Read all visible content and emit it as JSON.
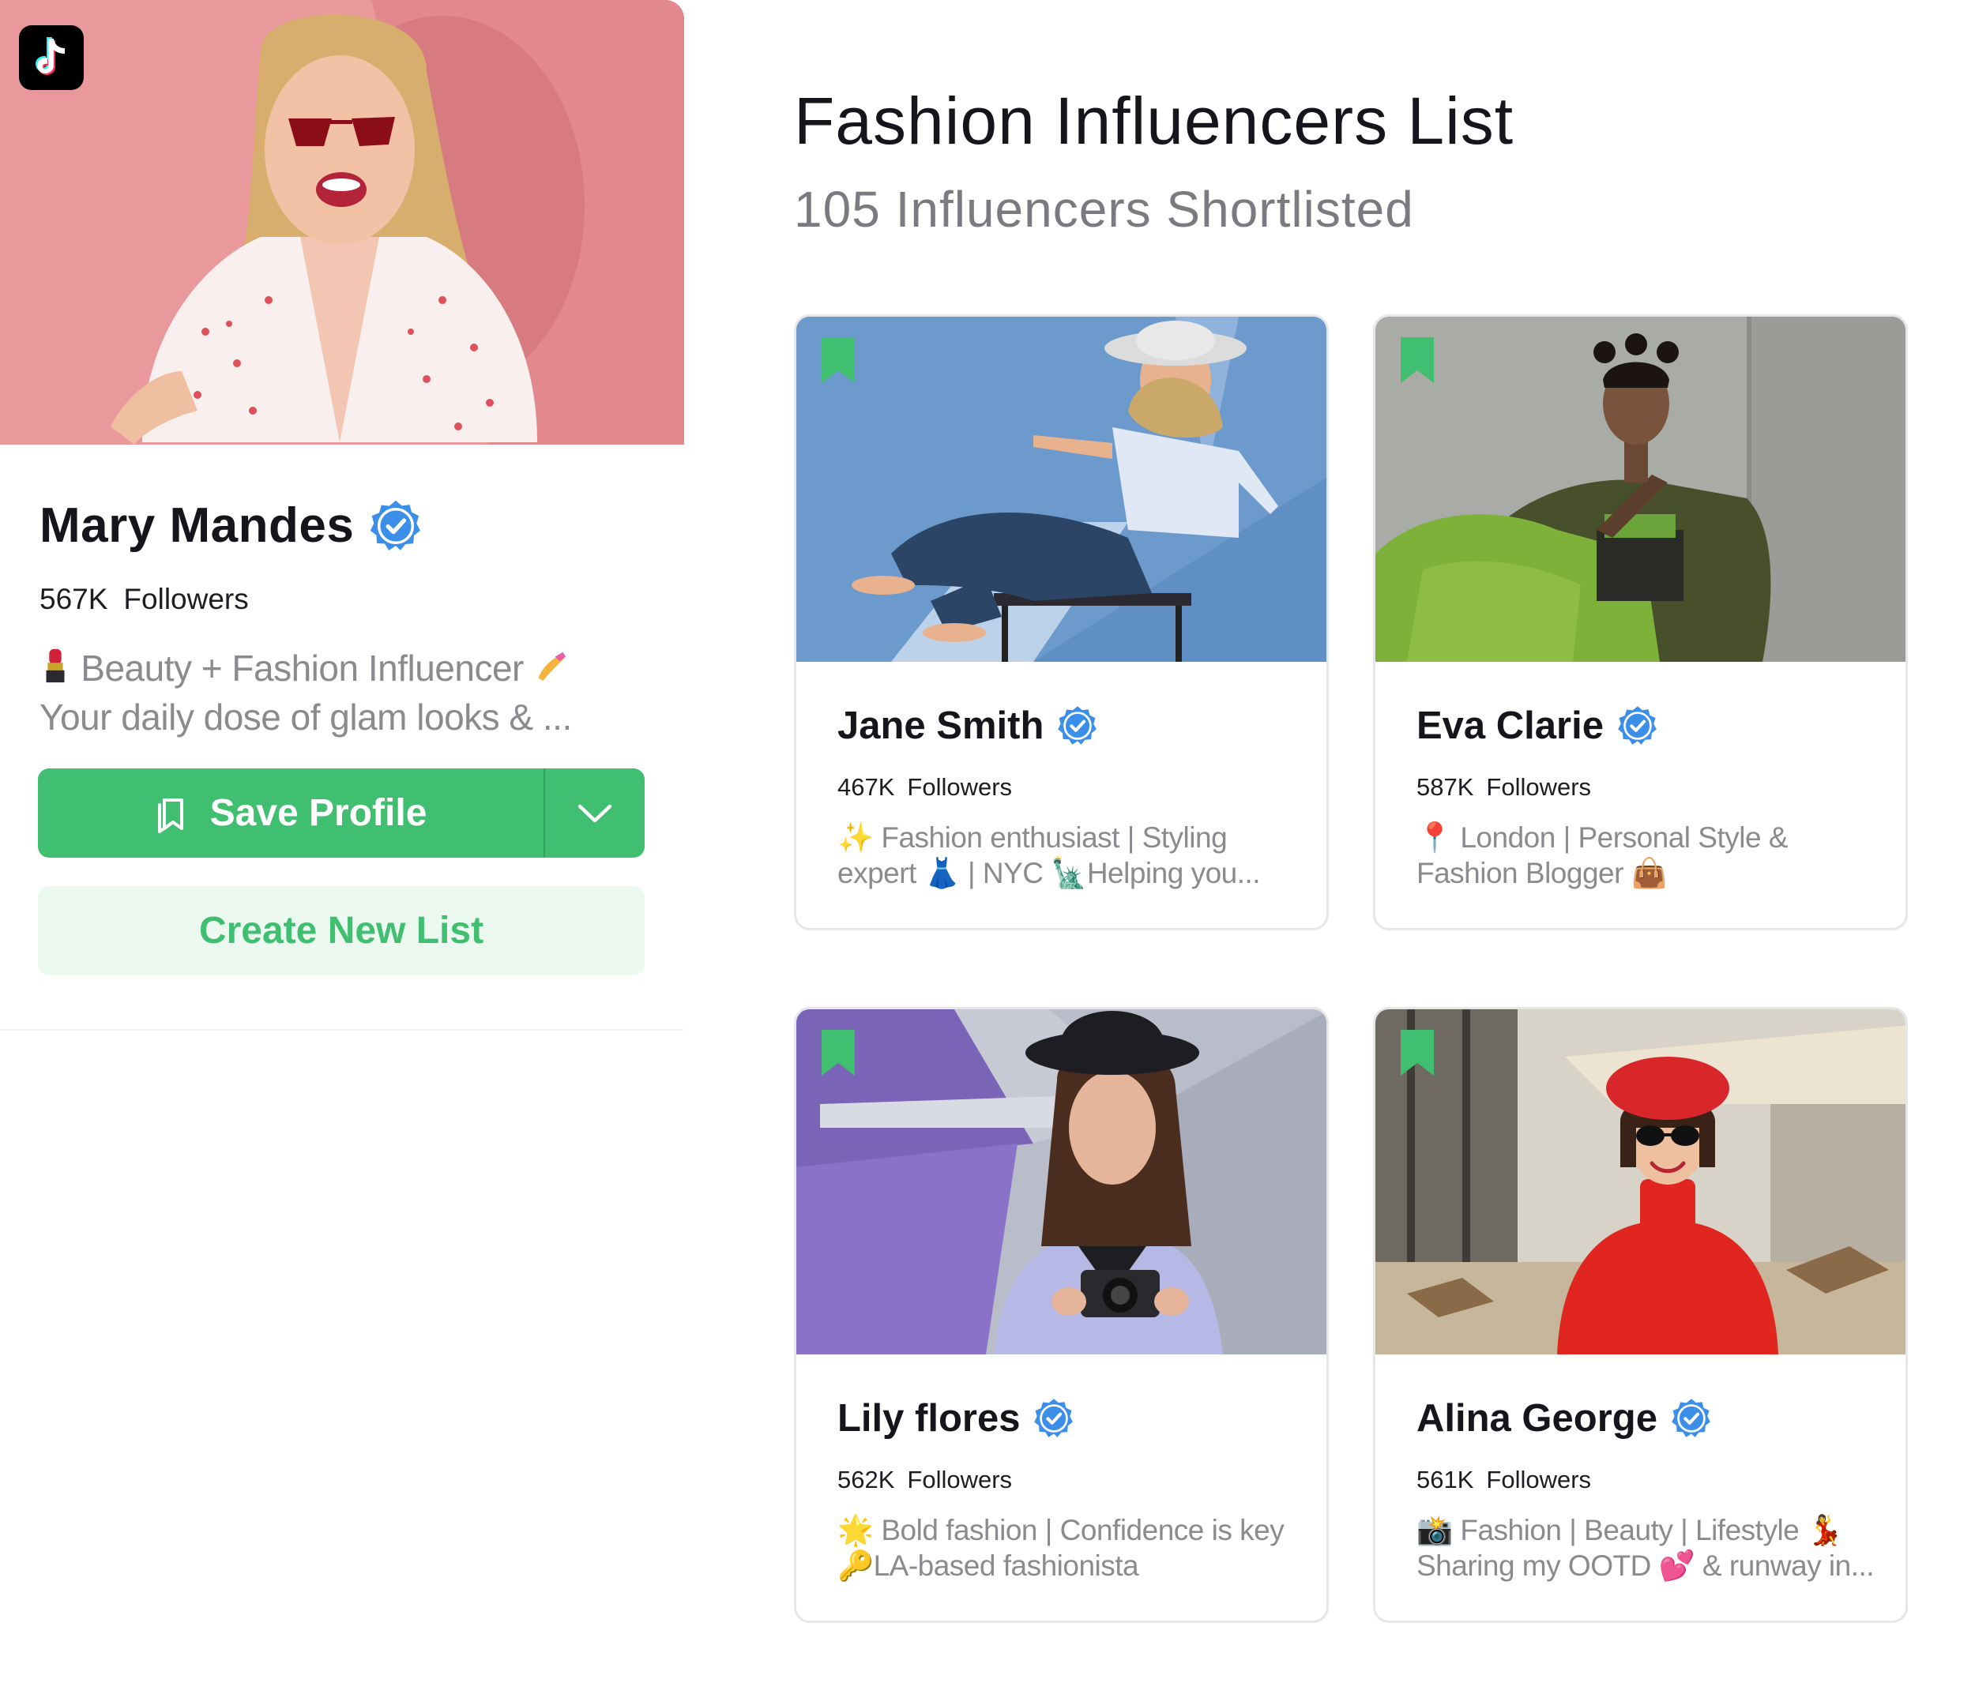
{
  "profile": {
    "platform_icon": "tiktok-icon",
    "name": "Mary Mandes",
    "followers_count": "567K",
    "followers_label": "Followers",
    "bio_line1": "Beauty + Fashion Influencer",
    "bio_line2": "Your daily dose of glam looks & ...",
    "save_label": "Save Profile",
    "create_label": "Create New List"
  },
  "list": {
    "title": "Fashion Influencers List",
    "subtitle": "105 Influencers Shortlisted"
  },
  "cards": [
    {
      "name": "Jane Smith",
      "followers_count": "467K",
      "followers_label": "Followers",
      "bio_line1": "✨ Fashion enthusiast | Styling",
      "bio_line2": "expert 👗 | NYC 🗽Helping you..."
    },
    {
      "name": "Eva Clarie",
      "followers_count": "587K",
      "followers_label": "Followers",
      "bio_line1": "📍 London | Personal Style &",
      "bio_line2": "Fashion Blogger 👜"
    },
    {
      "name": "Lily flores",
      "followers_count": "562K",
      "followers_label": "Followers",
      "bio_line1": "🌟 Bold fashion | Confidence is key",
      "bio_line2": "🔑LA-based fashionista"
    },
    {
      "name": "Alina George",
      "followers_count": "561K",
      "followers_label": "Followers",
      "bio_line1": "📸 Fashion | Beauty | Lifestyle 💃",
      "bio_line2": "Sharing my OOTD 💕 & runway in..."
    }
  ],
  "colors": {
    "accent_green": "#3fbf6f",
    "light_green": "#ecf9f0",
    "verified_blue": "#3b8fe8"
  }
}
